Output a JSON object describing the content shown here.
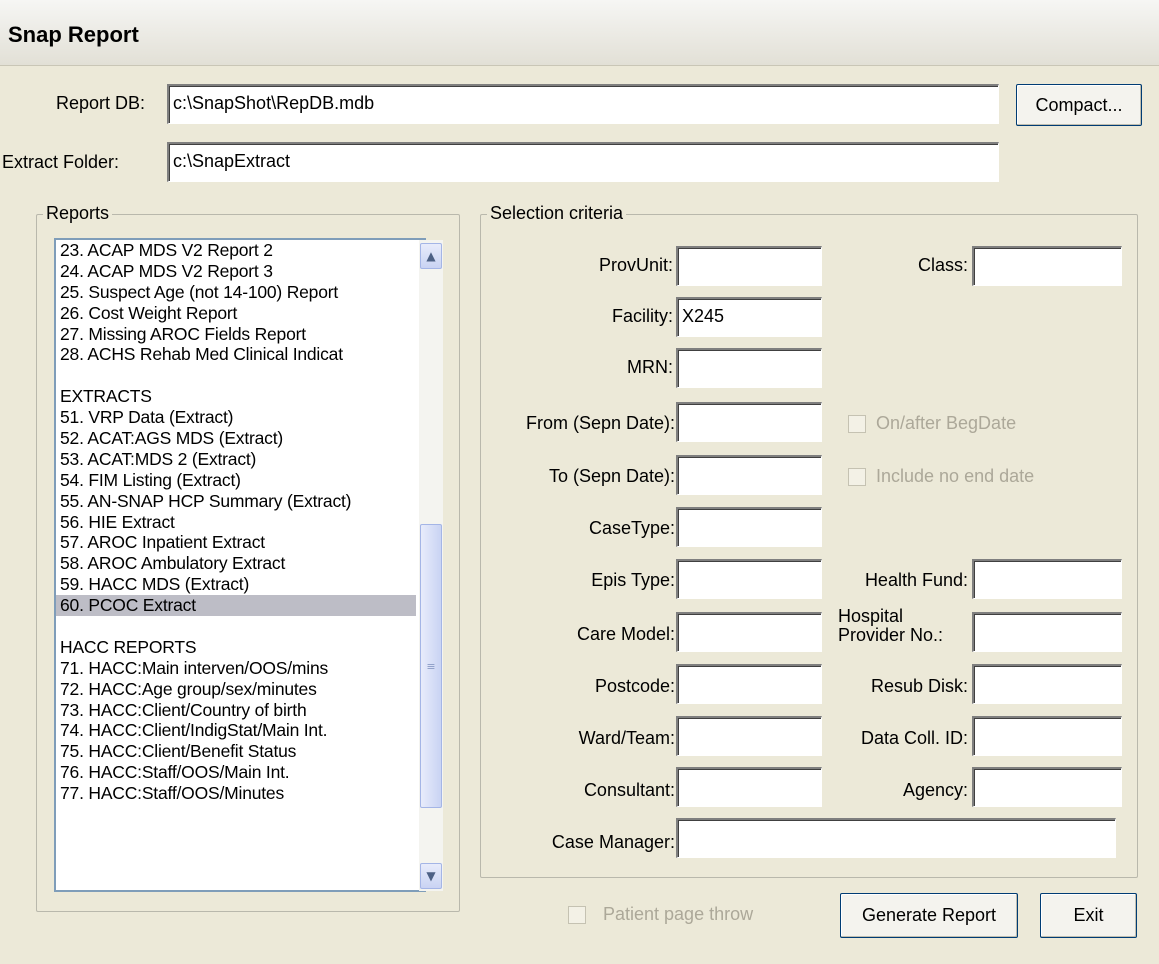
{
  "window": {
    "title": "Snap Report"
  },
  "top": {
    "report_db_label": "Report DB:",
    "report_db_value": "c:\\SnapShot\\RepDB.mdb",
    "compact_label": "Compact...",
    "extract_folder_label": "Extract Folder:",
    "extract_folder_value": "c:\\SnapExtract"
  },
  "reports": {
    "title": "Reports",
    "items": [
      "23. ACAP MDS V2 Report 2",
      "24. ACAP MDS V2 Report 3",
      "25. Suspect Age (not 14-100) Report",
      "26. Cost Weight Report",
      "27. Missing AROC Fields Report",
      "28. ACHS Rehab Med Clinical Indicat",
      "",
      "EXTRACTS",
      "51. VRP Data (Extract)",
      "52. ACAT:AGS MDS (Extract)",
      "53. ACAT:MDS 2 (Extract)",
      "54. FIM Listing (Extract)",
      "55. AN-SNAP HCP Summary (Extract)",
      "56. HIE Extract",
      "57. AROC Inpatient Extract",
      "58. AROC Ambulatory Extract",
      "59. HACC MDS (Extract)",
      "60. PCOC Extract",
      "",
      "HACC REPORTS",
      "71. HACC:Main interven/OOS/mins",
      "72. HACC:Age group/sex/minutes",
      "73. HACC:Client/Country of birth",
      "74. HACC:Client/IndigStat/Main Int.",
      "75. HACC:Client/Benefit Status",
      "76. HACC:Staff/OOS/Main Int.",
      "77. HACC:Staff/OOS/Minutes"
    ],
    "selected_index": 17
  },
  "criteria": {
    "title": "Selection criteria",
    "provunit_label": "ProvUnit:",
    "provunit_value": "",
    "class_label": "Class:",
    "class_value": "",
    "facility_label": "Facility:",
    "facility_value": "X245",
    "mrn_label": "MRN:",
    "mrn_value": "",
    "from_label": "From (Sepn Date):",
    "from_value": "",
    "onafter_label": "On/after BegDate",
    "to_label": "To (Sepn Date):",
    "to_value": "",
    "noend_label": "Include no end date",
    "casetype_label": "CaseType:",
    "casetype_value": "",
    "epistype_label": "Epis Type:",
    "epistype_value": "",
    "healthfund_label": "Health Fund:",
    "healthfund_value": "",
    "caremodel_label": "Care Model:",
    "caremodel_value": "",
    "hospprov_label_line1": "Hospital",
    "hospprov_label_line2": "Provider No.:",
    "hospprov_value": "",
    "postcode_label": "Postcode:",
    "postcode_value": "",
    "resub_label": "Resub Disk:",
    "resub_value": "",
    "ward_label": "Ward/Team:",
    "ward_value": "",
    "datacoll_label": "Data Coll. ID:",
    "datacoll_value": "",
    "consultant_label": "Consultant:",
    "consultant_value": "",
    "agency_label": "Agency:",
    "agency_value": "",
    "casemgr_label": "Case Manager:",
    "casemgr_value": ""
  },
  "bottom": {
    "patient_throw_label": "Patient page throw",
    "generate_label": "Generate Report",
    "exit_label": "Exit"
  }
}
